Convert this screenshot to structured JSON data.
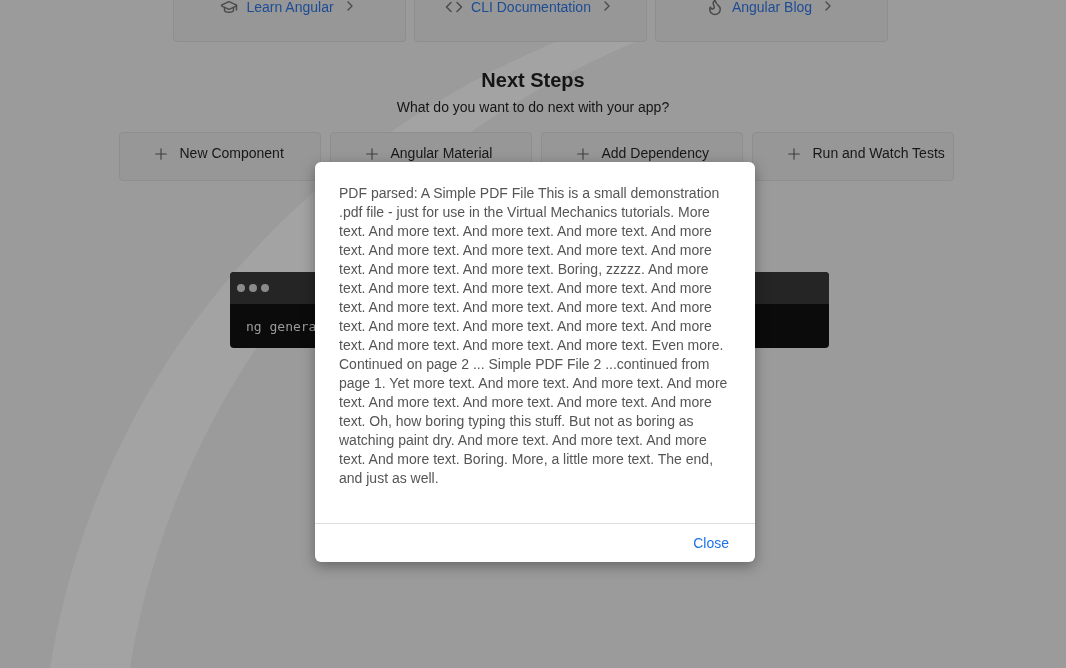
{
  "resource_links": [
    {
      "label": "Learn Angular"
    },
    {
      "label": "CLI Documentation"
    },
    {
      "label": "Angular Blog"
    }
  ],
  "next_steps": {
    "title": "Next Steps",
    "subtitle": "What do you want to do next with your app?",
    "buttons": [
      {
        "label": "New Component"
      },
      {
        "label": "Angular Material"
      },
      {
        "label": "Add Dependency"
      },
      {
        "label": "Run and Watch Tests"
      }
    ]
  },
  "terminal": {
    "command": "ng genera"
  },
  "dialog": {
    "text": "PDF parsed:  A Simple PDF File  This is a small demonstration .pdf file -  just for use in the Virtual Mechanics tutorials. More text. And more  text. And more text. And more text. And more text.  And more text. And more text. And more text. And more text. And more  text. And more text. Boring, zzzzz. And more text. And more text. And  more text. And more text. And more text. And more text. And more text.  And more text. And more text.  And more text. And more text. And more text. And more text. And more  text. And more text. And more text. Even more. Continued on page 2 ... Simple PDF File 2  ...continued from page 1. Yet more text. And more text. And more text.  And more text. And more text. And more text. And more text. And more  text. Oh, how boring typing this stuff. But not as boring as watching  paint dry. And more text. And more text. And more text. And more text.  Boring.  More, a little more text. The end, and just as well.",
    "close": "Close"
  }
}
